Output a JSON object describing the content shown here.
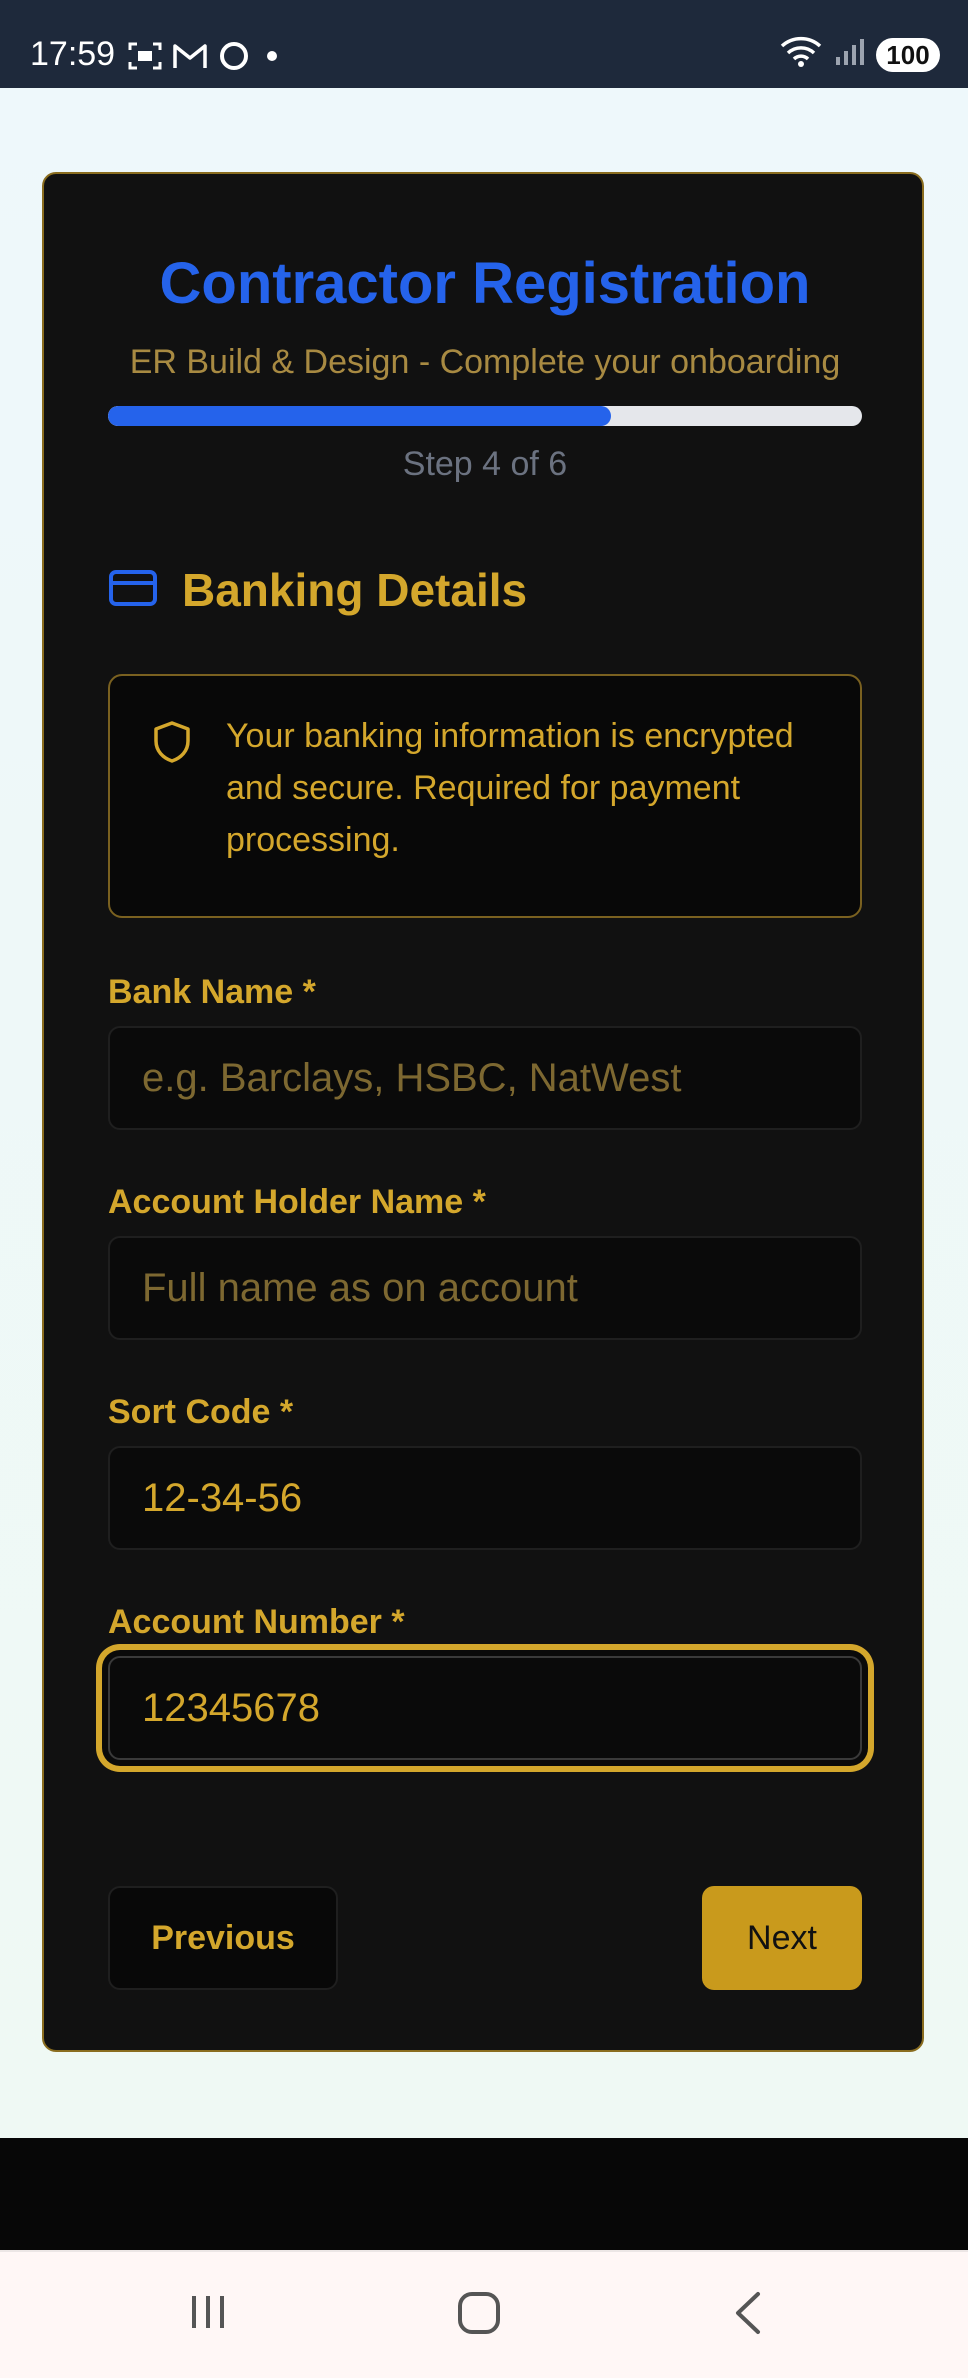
{
  "status_bar": {
    "time": "17:59",
    "battery": "100"
  },
  "form": {
    "title": "Contractor Registration",
    "subtitle": "ER Build & Design - Complete your onboarding",
    "progress_fraction": 0.667,
    "step_text": "Step 4 of 6",
    "section_title": "Banking Details",
    "notice_text": "Your banking information is encrypted and secure. Required for payment processing.",
    "fields": {
      "bank_name": {
        "label": "Bank Name *",
        "value": "",
        "placeholder": "e.g. Barclays, HSBC, NatWest"
      },
      "account_holder": {
        "label": "Account Holder Name *",
        "value": "",
        "placeholder": "Full name as on account"
      },
      "sort_code": {
        "label": "Sort Code *",
        "value": "12-34-56",
        "placeholder": ""
      },
      "account_number": {
        "label": "Account Number *",
        "value": "12345678",
        "placeholder": ""
      }
    },
    "buttons": {
      "previous": "Previous",
      "next": "Next"
    }
  },
  "colors": {
    "accent_blue": "#2563eb",
    "gold": "#d4a72c",
    "card_bg": "#111111"
  },
  "icons": {
    "section": "credit-card-icon",
    "notice": "shield-icon"
  }
}
